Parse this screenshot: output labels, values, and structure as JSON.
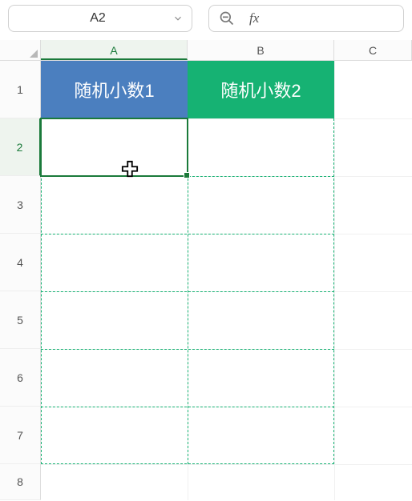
{
  "toolbar": {
    "namebox_value": "A2",
    "fx_label": "fx"
  },
  "columns": {
    "A": "A",
    "B": "B",
    "C": "C"
  },
  "rows": {
    "r1": "1",
    "r2": "2",
    "r3": "3",
    "r4": "4",
    "r5": "5",
    "r6": "6",
    "r7": "7",
    "r8": "8"
  },
  "cells": {
    "A1": "随机小数1",
    "B1": "随机小数2"
  },
  "colors": {
    "headerA_bg": "#4b7fbf",
    "headerB_bg": "#16b273",
    "selection": "#1a7a3a"
  },
  "selection": {
    "active_cell": "A2"
  }
}
